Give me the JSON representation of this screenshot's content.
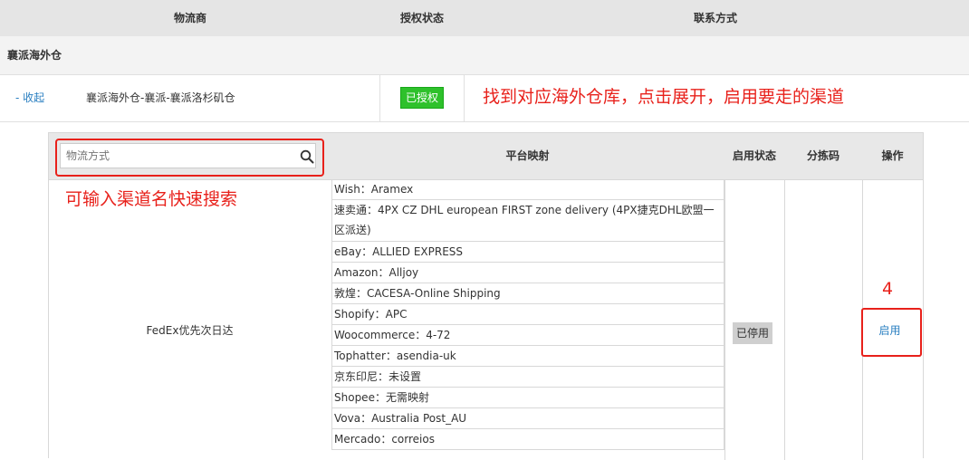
{
  "header": {
    "col_provider": "物流商",
    "col_auth": "授权状态",
    "col_contact": "联系方式"
  },
  "group": {
    "name": "襄派海外仓"
  },
  "provider": {
    "collapse_label": "- 收起",
    "name": "襄派海外仓-襄派-襄派洛杉矶仓",
    "auth_status": "已授权",
    "annotation": "找到对应海外仓库，点击展开，启用要走的渠道"
  },
  "channel_table": {
    "search_placeholder": "物流方式",
    "search_annotation": "可输入渠道名快速搜索",
    "col_mapping": "平台映射",
    "col_status": "启用状态",
    "col_sort_code": "分拣码",
    "col_action": "操作",
    "rows": [
      {
        "channel_name": "FedEx优先次日达",
        "status": "已停用",
        "sort_code": "",
        "action": "启用",
        "step_number": "4",
        "mappings": [
          "Wish：Aramex",
          "速卖通：4PX CZ DHL european FIRST zone delivery (4PX捷克DHL欧盟一区派送)",
          "eBay：ALLIED EXPRESS",
          "Amazon：Alljoy",
          "敦煌：CACESA-Online Shipping",
          "Shopify：APC",
          "Woocommerce：4-72",
          "Tophatter：asendia-uk",
          "京东印尼：未设置",
          "Shopee：无需映射",
          "Vova：Australia Post_AU",
          "Mercado：correios"
        ]
      }
    ]
  },
  "colors": {
    "annotation_red": "#e8211b",
    "link_blue": "#2a7fc1",
    "auth_green": "#2ec12b"
  }
}
